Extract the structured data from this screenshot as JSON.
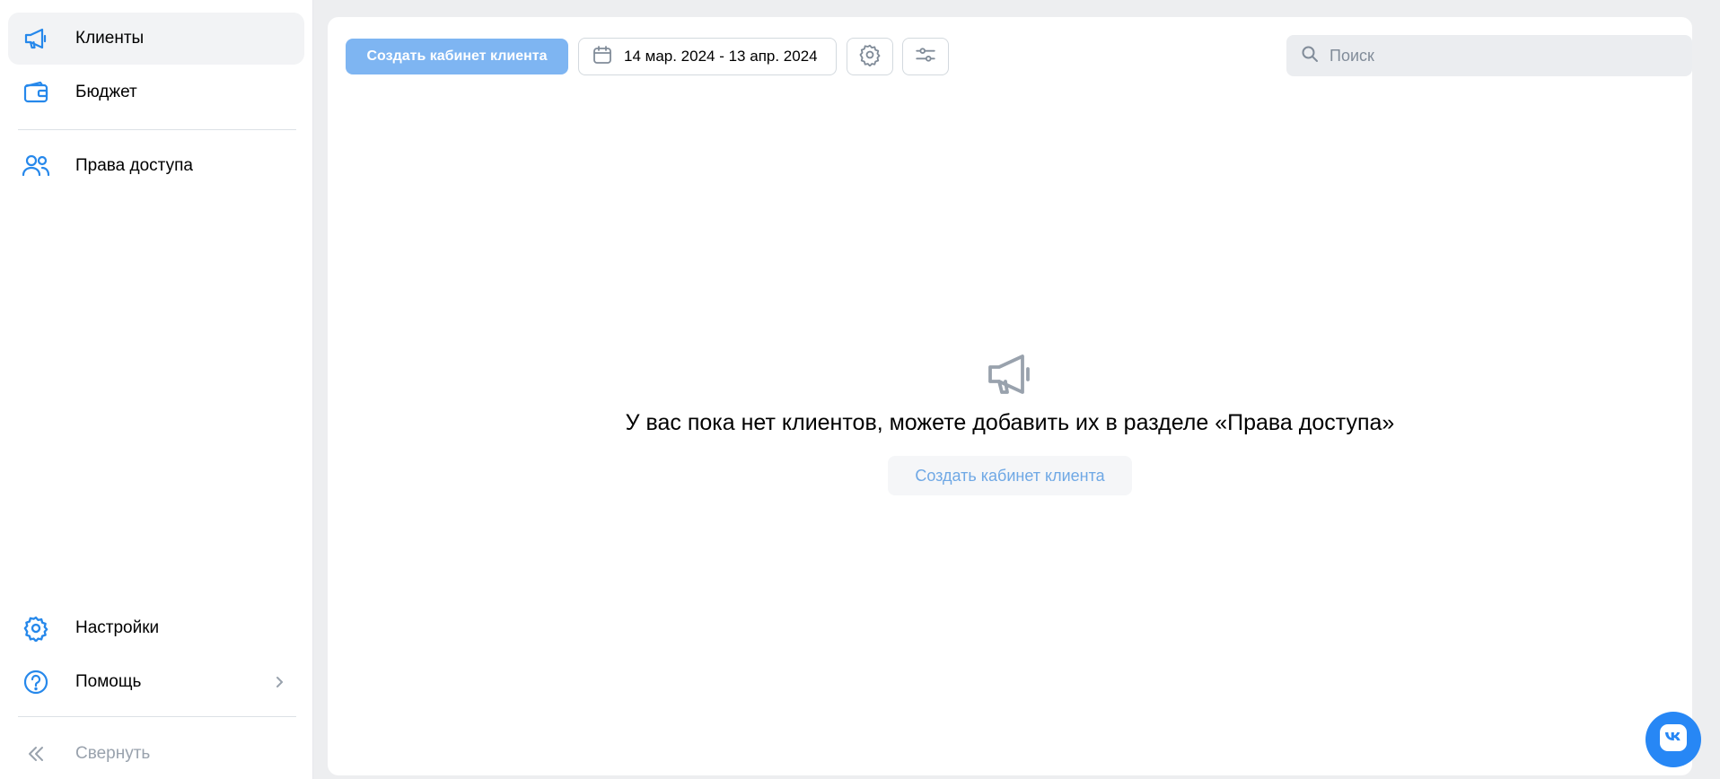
{
  "sidebar": {
    "items": [
      {
        "label": "Клиенты",
        "icon": "megaphone-icon"
      },
      {
        "label": "Бюджет",
        "icon": "wallet-icon"
      },
      {
        "label": "Права доступа",
        "icon": "users-icon"
      }
    ],
    "bottom": [
      {
        "label": "Настройки",
        "icon": "gear-icon"
      },
      {
        "label": "Помощь",
        "icon": "help-icon"
      },
      {
        "label": "Свернуть",
        "icon": "collapse-icon"
      }
    ]
  },
  "toolbar": {
    "create_label": "Создать кабинет клиента",
    "date_range": "14 мар. 2024 - 13 апр. 2024",
    "search_placeholder": "Поиск"
  },
  "empty_state": {
    "message": "У вас пока нет клиентов, можете добавить их в разделе «Права доступа»",
    "button_label": "Создать кабинет клиента"
  },
  "colors": {
    "accent": "#2787f5",
    "primary_button": "#7eb5f2",
    "icon_blue": "#2688eb"
  }
}
